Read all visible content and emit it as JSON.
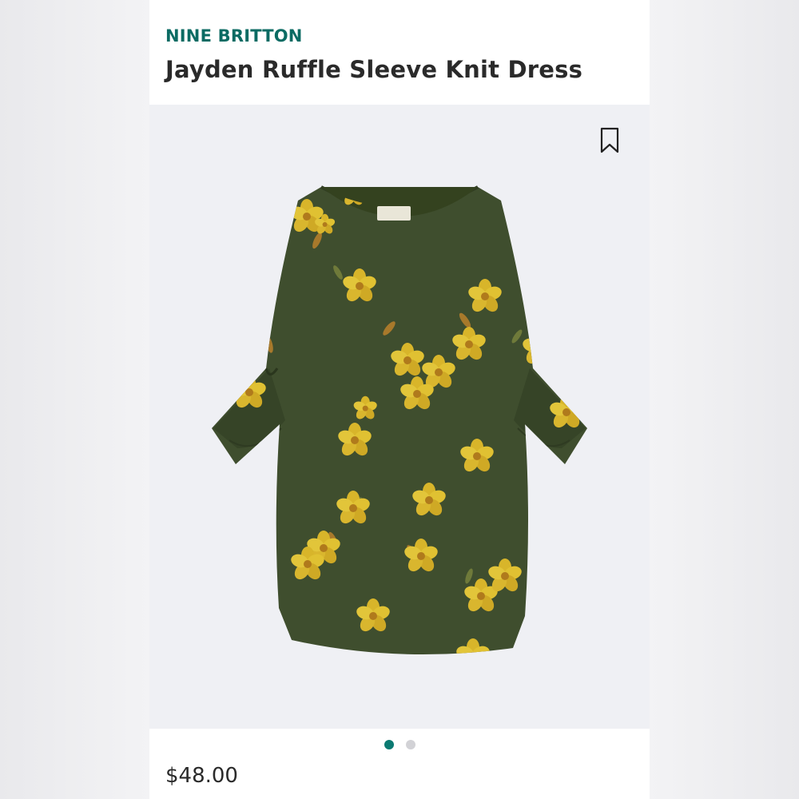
{
  "product": {
    "brand": "NINE BRITTON",
    "name": "Jayden Ruffle Sleeve Knit Dress",
    "price": "$48.00"
  },
  "gallery": {
    "image_description": "olive green knit dress with yellow floral print and ruffle bell sleeves",
    "slide_count": 2,
    "active_slide": 1
  },
  "icons": {
    "save": "bookmark-icon"
  },
  "colors": {
    "brand_text": "#0b6b63",
    "active_dot": "#0b7a72",
    "inactive_dot": "#d2d2d6",
    "dress_green": "#3f4e2e",
    "flower_yellow": "#d9b62a"
  }
}
